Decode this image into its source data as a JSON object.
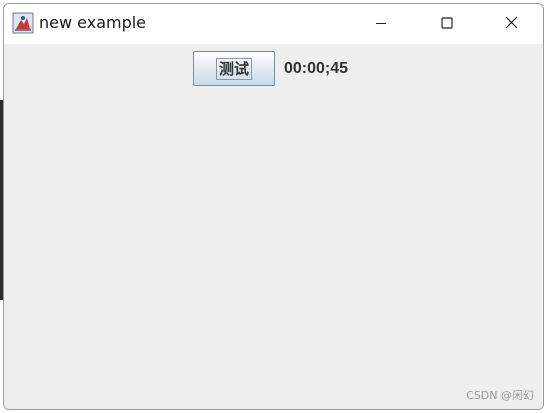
{
  "window": {
    "title": "new example",
    "icon": "java-icon",
    "controls": {
      "minimize_icon": "minimize-icon",
      "maximize_icon": "maximize-icon",
      "close_icon": "close-icon"
    }
  },
  "content": {
    "test_button_label": "测试",
    "timer_text": "00:00;45"
  },
  "watermark": "CSDN @闲幻",
  "colors": {
    "content_background": "#eeeeee",
    "titlebar_background": "#ffffff",
    "button_gradient_top": "#ffffff",
    "button_gradient_bottom": "#c9dbea",
    "text": "#333333"
  }
}
